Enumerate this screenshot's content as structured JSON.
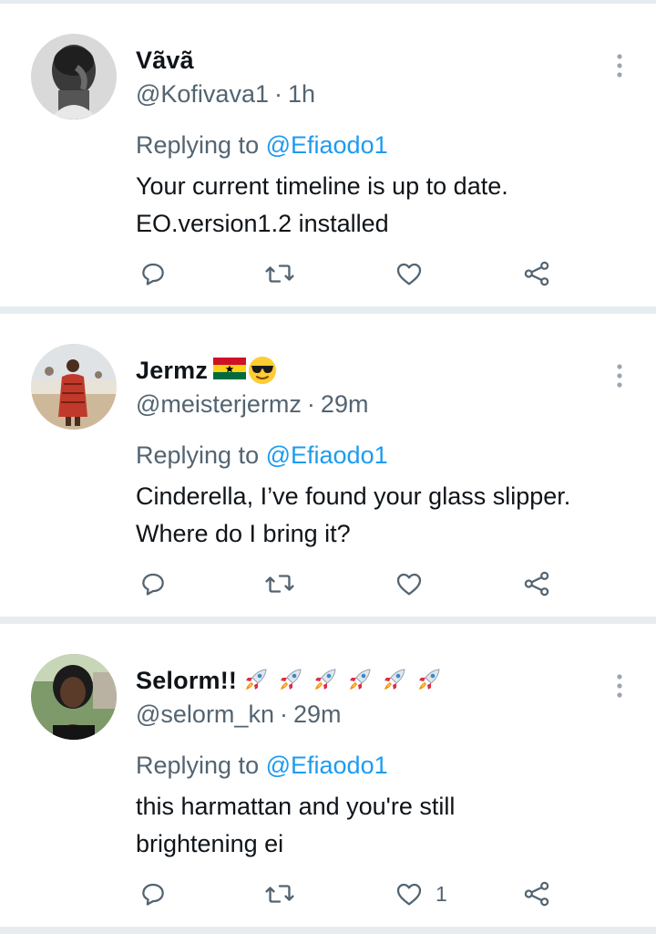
{
  "tweets": [
    {
      "name": "Vãvã",
      "handle": "@Kofivava1",
      "time": "1h",
      "replying_prefix": "Replying to",
      "replying_to": "@Efiaodo1",
      "lines": [
        "Your current timeline is up to date.",
        "EO.version1.2 installed"
      ],
      "like_count": "",
      "emojis": []
    },
    {
      "name": "Jermz",
      "handle": "@meisterjermz",
      "time": "29m",
      "replying_prefix": "Replying to",
      "replying_to": "@Efiaodo1",
      "lines": [
        "Cinderella, I’ve found your glass slipper.",
        "Where do I bring it?"
      ],
      "like_count": "",
      "emojis": [
        "ghana-flag-icon",
        "sunglasses-face-icon"
      ]
    },
    {
      "name": "Selorm!!",
      "handle": "@selorm_kn",
      "time": "29m",
      "replying_prefix": "Replying to",
      "replying_to": "@Efiaodo1",
      "lines": [
        "this harmattan and you're still",
        "brightening ei"
      ],
      "like_count": "1",
      "emojis": [
        "rocket-icon",
        "rocket-icon",
        "rocket-icon",
        "rocket-icon",
        "rocket-icon",
        "rocket-icon"
      ]
    }
  ],
  "separator": "·",
  "colors": {
    "text": "#0f1419",
    "secondary": "#536471",
    "link": "#1d9bf0",
    "divider": "#e6ecf0"
  }
}
